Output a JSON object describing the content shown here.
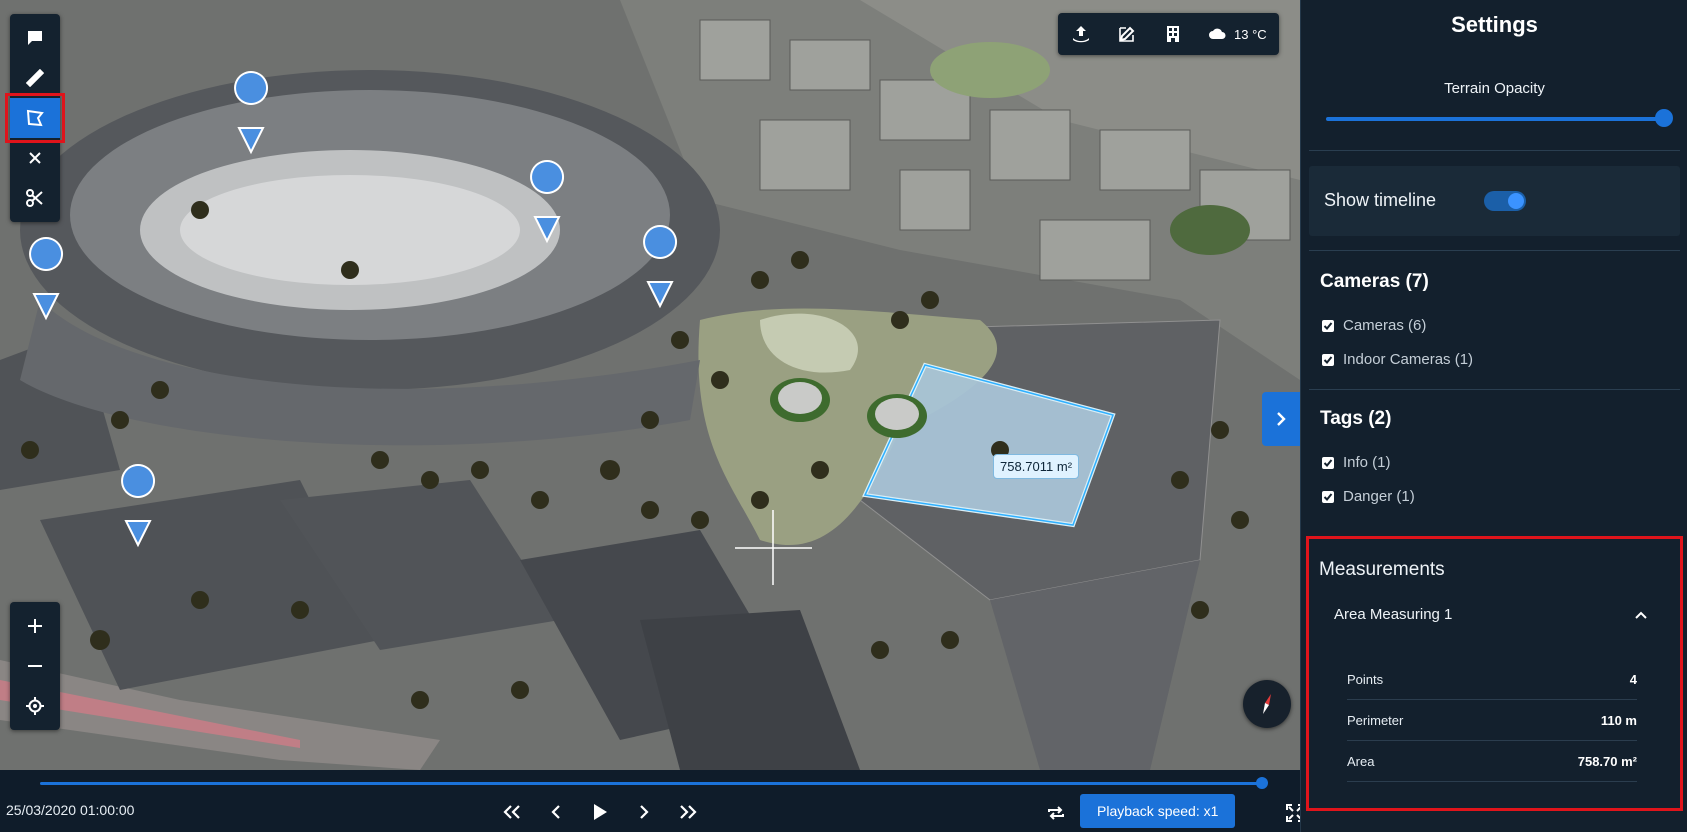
{
  "toolbar_left": {
    "items": [
      {
        "name": "comment-icon",
        "glyph": "comment"
      },
      {
        "name": "ruler-icon",
        "glyph": "ruler"
      },
      {
        "name": "area-measure-icon",
        "glyph": "area",
        "active": true
      },
      {
        "name": "close-icon",
        "glyph": "close"
      },
      {
        "name": "scissors-icon",
        "glyph": "scissors"
      }
    ]
  },
  "toolbar_top": {
    "weather_temp": "13 °C"
  },
  "viewport": {
    "area_label": "758.7011 m²"
  },
  "timeline": {
    "datetime": "25/03/2020 01:00:00",
    "playback_label": "Playback speed: x1",
    "progress": 0.995
  },
  "settings": {
    "title": "Settings",
    "terrain_opacity_label": "Terrain Opacity",
    "terrain_opacity_value": 1.0,
    "show_timeline_label": "Show timeline",
    "show_timeline_on": true,
    "cameras": {
      "heading": "Cameras (7)",
      "items": [
        "Cameras (6)",
        "Indoor Cameras (1)"
      ]
    },
    "tags": {
      "heading": "Tags (2)",
      "items": [
        "Info (1)",
        "Danger (1)"
      ]
    },
    "measurements": {
      "heading": "Measurements",
      "item_title": "Area Measuring 1",
      "rows": [
        {
          "label": "Points",
          "value": "4"
        },
        {
          "label": "Perimeter",
          "value": "110 m"
        },
        {
          "label": "Area",
          "value": "758.70 m²"
        }
      ]
    }
  },
  "colors": {
    "accent": "#1b72d9",
    "panel_bg": "#13202d",
    "highlight_red": "#e0141b"
  }
}
